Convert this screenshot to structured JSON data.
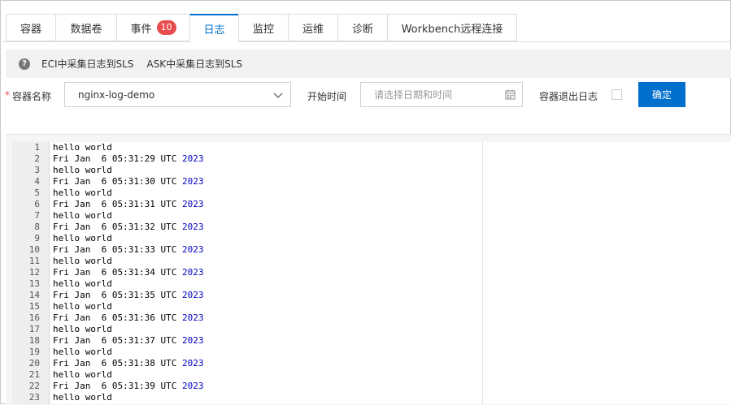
{
  "tabs": [
    {
      "label": "容器",
      "active": false,
      "width": 61
    },
    {
      "label": "数据卷",
      "active": false,
      "width": 75
    },
    {
      "label": "事件",
      "badge": "10",
      "active": false,
      "width": 90
    },
    {
      "label": "日志",
      "active": true,
      "width": 60
    },
    {
      "label": "监控",
      "active": false,
      "width": 61
    },
    {
      "label": "运维",
      "active": false,
      "width": 61
    },
    {
      "label": "诊断",
      "active": false,
      "width": 61
    },
    {
      "label": "Workbench远程连接",
      "active": false,
      "width": 160
    }
  ],
  "infobar": {
    "help_icon": "?",
    "links": [
      "ECI中采集日志到SLS",
      "ASK中采集日志到SLS"
    ]
  },
  "form": {
    "required_mark": "*",
    "container_label": "容器名称",
    "container_value": "nginx-log-demo",
    "start_time_label": "开始时间",
    "start_time_placeholder": "请选择日期和时间",
    "exit_log_label": "容器退出日志",
    "confirm_button": "确定"
  },
  "colors": {
    "accent": "#0070cc",
    "badge": "#e84d4d",
    "year": "#0000c0"
  },
  "log_lines": [
    {
      "n": "1",
      "text": "hello world"
    },
    {
      "n": "2",
      "text": "Fri Jan  6 05:31:29 UTC ",
      "year": "2023"
    },
    {
      "n": "3",
      "text": "hello world"
    },
    {
      "n": "4",
      "text": "Fri Jan  6 05:31:30 UTC ",
      "year": "2023"
    },
    {
      "n": "5",
      "text": "hello world"
    },
    {
      "n": "6",
      "text": "Fri Jan  6 05:31:31 UTC ",
      "year": "2023"
    },
    {
      "n": "7",
      "text": "hello world"
    },
    {
      "n": "8",
      "text": "Fri Jan  6 05:31:32 UTC ",
      "year": "2023"
    },
    {
      "n": "9",
      "text": "hello world"
    },
    {
      "n": "10",
      "text": "Fri Jan  6 05:31:33 UTC ",
      "year": "2023"
    },
    {
      "n": "11",
      "text": "hello world"
    },
    {
      "n": "12",
      "text": "Fri Jan  6 05:31:34 UTC ",
      "year": "2023"
    },
    {
      "n": "13",
      "text": "hello world"
    },
    {
      "n": "14",
      "text": "Fri Jan  6 05:31:35 UTC ",
      "year": "2023"
    },
    {
      "n": "15",
      "text": "hello world"
    },
    {
      "n": "16",
      "text": "Fri Jan  6 05:31:36 UTC ",
      "year": "2023"
    },
    {
      "n": "17",
      "text": "hello world"
    },
    {
      "n": "18",
      "text": "Fri Jan  6 05:31:37 UTC ",
      "year": "2023"
    },
    {
      "n": "19",
      "text": "hello world"
    },
    {
      "n": "20",
      "text": "Fri Jan  6 05:31:38 UTC ",
      "year": "2023"
    },
    {
      "n": "21",
      "text": "hello world"
    },
    {
      "n": "22",
      "text": "Fri Jan  6 05:31:39 UTC ",
      "year": "2023"
    },
    {
      "n": "23",
      "text": "hello world"
    }
  ]
}
